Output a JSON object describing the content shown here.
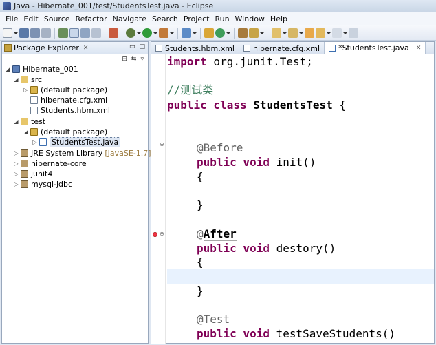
{
  "window": {
    "title": "Java - Hibernate_001/test/StudentsTest.java - Eclipse"
  },
  "menu": [
    "File",
    "Edit",
    "Source",
    "Refactor",
    "Navigate",
    "Search",
    "Project",
    "Run",
    "Window",
    "Help"
  ],
  "explorer": {
    "title": "Package Explorer",
    "tree": [
      {
        "label": "Hibernate_001",
        "icon": "project-icon",
        "indent": 0,
        "expanded": true
      },
      {
        "label": "src",
        "icon": "source-folder-icon",
        "indent": 1,
        "expanded": true
      },
      {
        "label": "(default package)",
        "icon": "package-icon",
        "indent": 2,
        "expanded": false
      },
      {
        "label": "hibernate.cfg.xml",
        "icon": "xml-file-icon",
        "indent": 2
      },
      {
        "label": "Students.hbm.xml",
        "icon": "xml-file-icon",
        "indent": 2
      },
      {
        "label": "test",
        "icon": "source-folder-icon",
        "indent": 1,
        "expanded": true
      },
      {
        "label": "(default package)",
        "icon": "package-icon",
        "indent": 2,
        "expanded": true
      },
      {
        "label": "StudentsTest.java",
        "icon": "java-file-icon",
        "indent": 3,
        "expanded": false,
        "selected": true
      },
      {
        "label": "JRE System Library",
        "suffix": "[JavaSE-1.7]",
        "icon": "library-icon",
        "indent": 1,
        "expanded": false
      },
      {
        "label": "hibernate-core",
        "icon": "library-icon",
        "indent": 1,
        "expanded": false
      },
      {
        "label": "junit4",
        "icon": "library-icon",
        "indent": 1,
        "expanded": false
      },
      {
        "label": "mysql-jdbc",
        "icon": "library-icon",
        "indent": 1,
        "expanded": false
      }
    ]
  },
  "editor": {
    "tabs": [
      {
        "label": "Students.hbm.xml",
        "active": false
      },
      {
        "label": "hibernate.cfg.xml",
        "active": false
      },
      {
        "label": "*StudentsTest.java",
        "active": true
      }
    ],
    "code": {
      "l1_kw": "import",
      "l1_rest": " org.junit.Test;",
      "l2_comment": "//测试类",
      "l3_kw": "public class",
      "l3_name": " StudentsTest",
      "l3_rest": " {",
      "l4_annotation": "@Before",
      "l5_kw": "public void",
      "l5_rest": " init()",
      "brace_open": "{",
      "brace_close": "}",
      "l8_at": "@",
      "l8_name": "After",
      "l9_kw": "public void",
      "l9_rest": " destory()",
      "l12_annotation": "@Test",
      "l13_kw": "public void",
      "l13_rest": " testSaveStudents()"
    }
  }
}
